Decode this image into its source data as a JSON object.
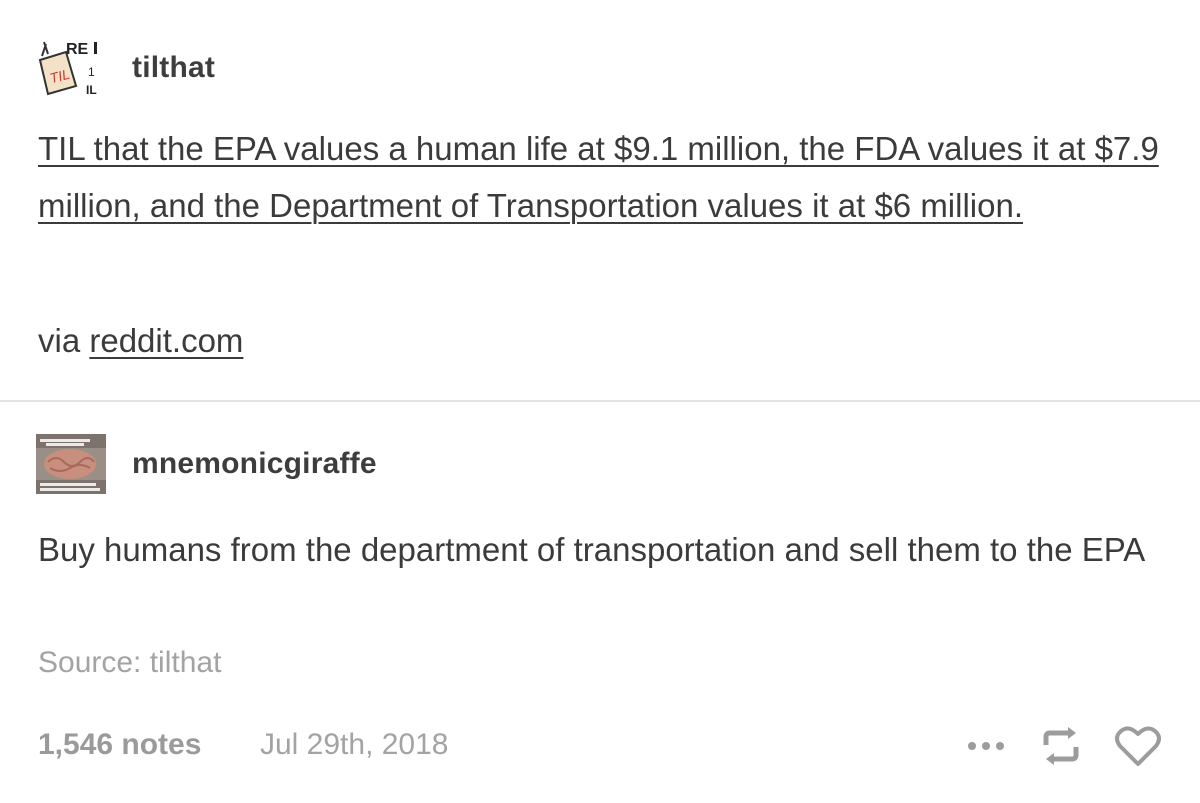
{
  "posts": [
    {
      "blog_name": "tilthat",
      "avatar_icon": "til-reddit-avatar-icon",
      "title_link": "TIL that the EPA values a human life at $9.1 million, the FDA values it at $7.9 million, and the Department of Transportation values it at $6 million.",
      "via_prefix": "via",
      "via_link": "reddit.com"
    },
    {
      "blog_name": "mnemonicgiraffe",
      "avatar_icon": "brain-meme-avatar-icon",
      "text": "Buy humans from the department of transportation and sell them to the EPA",
      "source": "Source: tilthat"
    }
  ],
  "footer": {
    "notes": "1,546 notes",
    "date": "Jul 29th, 2018",
    "icons": [
      "more-icon",
      "reblog-icon",
      "heart-icon"
    ]
  },
  "colors": {
    "text": "#3b3b3b",
    "muted": "#a3a3a3",
    "divider": "#e2e2e2",
    "background": "#ffffff"
  }
}
